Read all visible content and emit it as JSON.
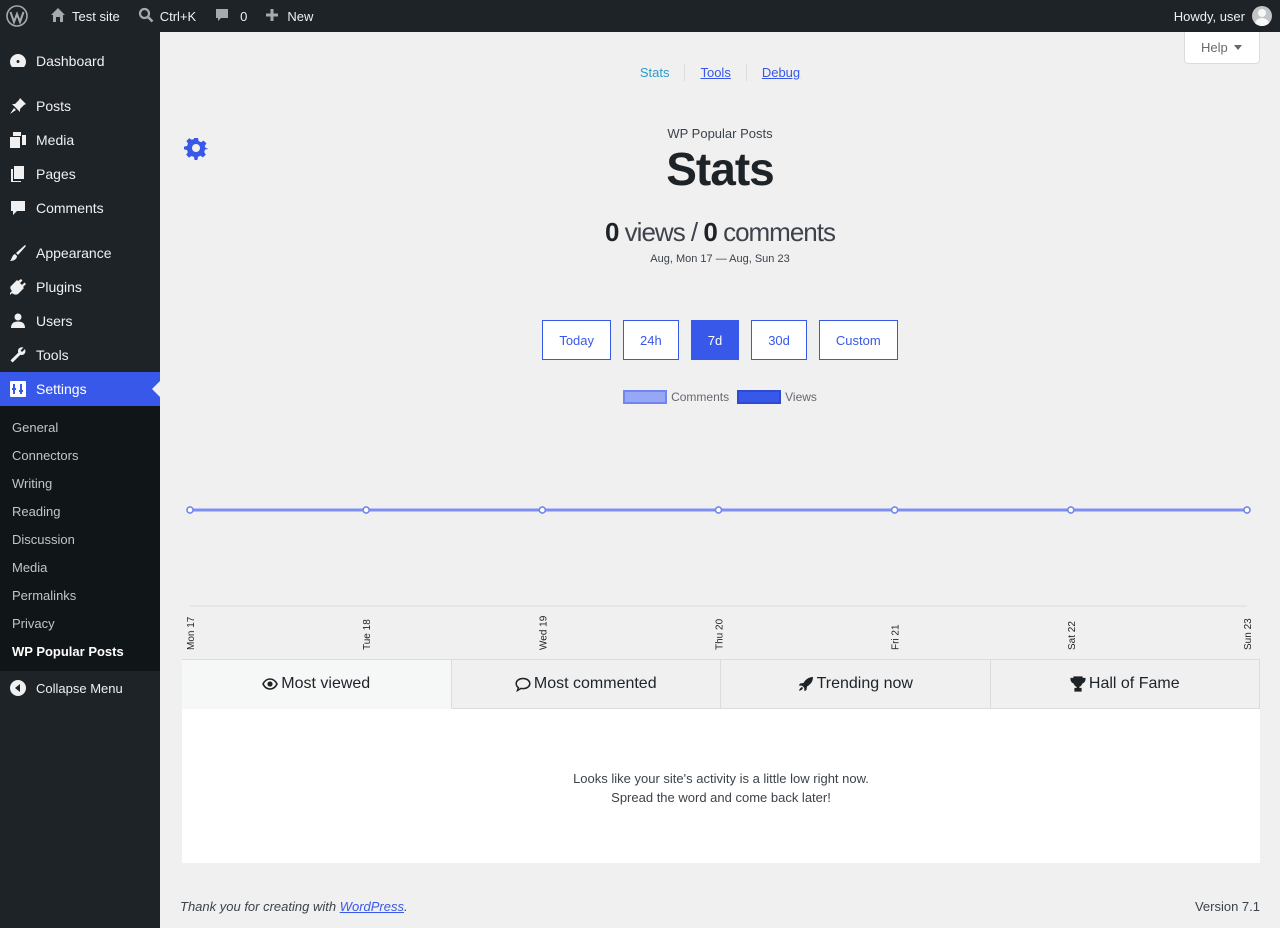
{
  "adminbar": {
    "site_name": "Test site",
    "search_shortcut": "Ctrl+K",
    "comments_count": "0",
    "new_label": "New",
    "greeting": "Howdy, user"
  },
  "sidebar": {
    "items": [
      {
        "label": "Dashboard",
        "icon": "dashboard-icon"
      },
      {
        "label": "Posts",
        "icon": "pin-icon"
      },
      {
        "label": "Media",
        "icon": "media-icon"
      },
      {
        "label": "Pages",
        "icon": "pages-icon"
      },
      {
        "label": "Comments",
        "icon": "comment-icon"
      },
      {
        "label": "Appearance",
        "icon": "brush-icon"
      },
      {
        "label": "Plugins",
        "icon": "plugin-icon"
      },
      {
        "label": "Users",
        "icon": "user-icon"
      },
      {
        "label": "Tools",
        "icon": "wrench-icon"
      },
      {
        "label": "Settings",
        "icon": "settings-icon"
      }
    ],
    "submenu": [
      "General",
      "Connectors",
      "Writing",
      "Reading",
      "Discussion",
      "Media",
      "Permalinks",
      "Privacy",
      "WP Popular Posts"
    ],
    "collapse_label": "Collapse Menu"
  },
  "help_label": "Help",
  "subnav": [
    "Stats",
    "Tools",
    "Debug"
  ],
  "plugin_name": "WP Popular Posts",
  "page_title": "Stats",
  "summary": {
    "views": "0",
    "views_label": " views / ",
    "comments": "0",
    "comments_label": " comments"
  },
  "date_range": "Aug, Mon 17 — Aug, Sun 23",
  "range_buttons": [
    "Today",
    "24h",
    "7d",
    "30d",
    "Custom"
  ],
  "active_range": "7d",
  "chart_data": {
    "type": "line",
    "categories": [
      "Mon 17",
      "Tue 18",
      "Wed 19",
      "Thu 20",
      "Fri 21",
      "Sat 22",
      "Sun 23"
    ],
    "series": [
      {
        "name": "Comments",
        "values": [
          0,
          0,
          0,
          0,
          0,
          0,
          0
        ],
        "color": "#98a7f4"
      },
      {
        "name": "Views",
        "values": [
          0,
          0,
          0,
          0,
          0,
          0,
          0
        ],
        "color": "#3858e9"
      }
    ],
    "legend": "top-center",
    "grid": false
  },
  "tabs": [
    {
      "label": "Most viewed",
      "icon": "eye-icon"
    },
    {
      "label": "Most commented",
      "icon": "comment-icon"
    },
    {
      "label": "Trending now",
      "icon": "rocket-icon"
    },
    {
      "label": "Hall of Fame",
      "icon": "trophy-icon"
    }
  ],
  "empty_message": {
    "line1": "Looks like your site's activity is a little low right now.",
    "line2": "Spread the word and come back later!"
  },
  "footer": {
    "thanks_prefix": "Thank you for creating with ",
    "link": "WordPress",
    "suffix": ".",
    "version": "Version 7.1"
  }
}
